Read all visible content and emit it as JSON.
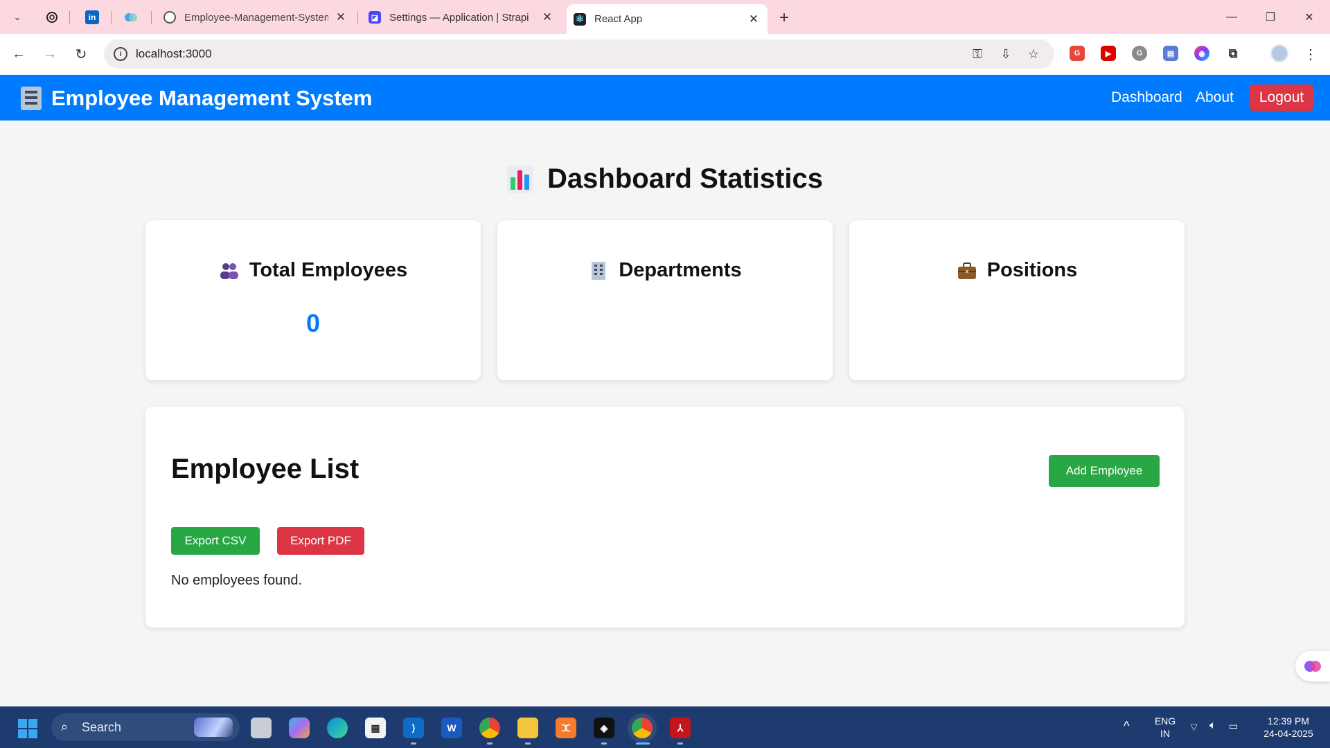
{
  "browser": {
    "tabs": [
      {
        "title": "Employee-Management-System"
      },
      {
        "title": "Settings — Application | Strapi"
      },
      {
        "title": "React App"
      }
    ],
    "tab_close_glyph": "✕",
    "new_tab_glyph": "+",
    "url": "localhost:3000",
    "window_controls": {
      "minimize": "—",
      "restore": "❐",
      "close": "✕"
    }
  },
  "app": {
    "brand": "Employee Management System",
    "nav": {
      "dashboard": "Dashboard",
      "about": "About",
      "logout": "Logout"
    }
  },
  "dashboard": {
    "title": "Dashboard Statistics",
    "cards": [
      {
        "label": "Total Employees",
        "value": "0",
        "icon": "people-icon"
      },
      {
        "label": "Departments",
        "value": "",
        "icon": "building-icon"
      },
      {
        "label": "Positions",
        "value": "",
        "icon": "briefcase-icon"
      }
    ]
  },
  "employee_list": {
    "title": "Employee List",
    "add_button": "Add Employee",
    "export_csv": "Export CSV",
    "export_pdf": "Export PDF",
    "empty_message": "No employees found."
  },
  "taskbar": {
    "search_placeholder": "Search",
    "language": "ENG",
    "region": "IN",
    "time": "12:39 PM",
    "date": "24-04-2025"
  },
  "colors": {
    "primary": "#007bff",
    "success": "#28a745",
    "danger": "#dc3545",
    "tabstrip": "#fcd9e1",
    "taskbar": "#1d3b6e"
  }
}
